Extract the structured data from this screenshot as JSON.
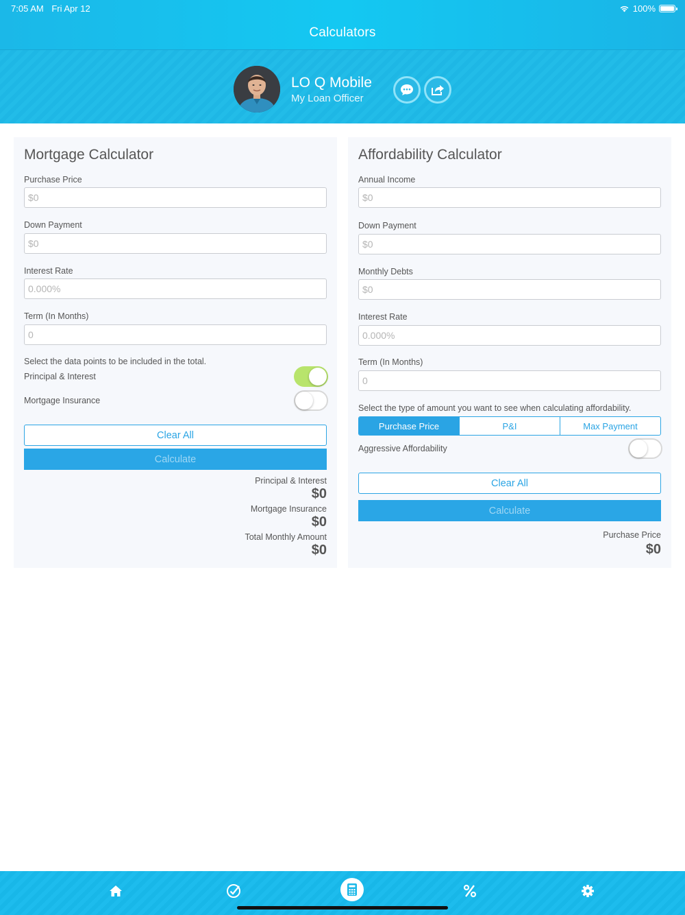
{
  "status_bar": {
    "time": "7:05 AM",
    "date": "Fri Apr 12",
    "battery": "100%"
  },
  "nav": {
    "title": "Calculators"
  },
  "profile": {
    "name": "LO Q Mobile",
    "role": "My Loan Officer"
  },
  "mortgage": {
    "title": "Mortgage Calculator",
    "purchase_price": {
      "label": "Purchase Price",
      "placeholder": "$0"
    },
    "down_payment": {
      "label": "Down Payment",
      "placeholder": "$0"
    },
    "interest_rate": {
      "label": "Interest Rate",
      "placeholder": "0.000%"
    },
    "term": {
      "label": "Term (In Months)",
      "placeholder": "0"
    },
    "select_text": "Select the data points to be included in the total.",
    "toggle_pi": {
      "label": "Principal & Interest",
      "on": true
    },
    "toggle_mi": {
      "label": "Mortgage Insurance",
      "on": false
    },
    "clear_label": "Clear All",
    "calculate_label": "Calculate",
    "results": [
      {
        "label": "Principal & Interest",
        "value": "$0"
      },
      {
        "label": "Mortgage Insurance",
        "value": "$0"
      },
      {
        "label": "Total Monthly Amount",
        "value": "$0"
      }
    ]
  },
  "affordability": {
    "title": "Affordability Calculator",
    "annual_income": {
      "label": "Annual Income",
      "placeholder": "$0"
    },
    "down_payment": {
      "label": "Down Payment",
      "placeholder": "$0"
    },
    "monthly_debts": {
      "label": "Monthly Debts",
      "placeholder": "$0"
    },
    "interest_rate": {
      "label": "Interest Rate",
      "placeholder": "0.000%"
    },
    "term": {
      "label": "Term (In Months)",
      "placeholder": "0"
    },
    "select_text": "Select the type of amount you want to see when calculating affordability.",
    "segments": [
      "Purchase Price",
      "P&I",
      "Max Payment"
    ],
    "selected_segment": "Purchase Price",
    "aggressive": {
      "label": "Aggressive Affordability",
      "on": false
    },
    "clear_label": "Clear All",
    "calculate_label": "Calculate",
    "result": {
      "label": "Purchase Price",
      "value": "$0"
    }
  },
  "tabs": [
    {
      "icon": "home-icon"
    },
    {
      "icon": "checkmark-icon"
    },
    {
      "icon": "calculator-icon",
      "active": true
    },
    {
      "icon": "percent-icon"
    },
    {
      "icon": "gear-icon"
    }
  ],
  "colors": {
    "brand": "#1bb8e8",
    "accent": "#2aa4e4",
    "toggle_on": "#b8e46c"
  }
}
